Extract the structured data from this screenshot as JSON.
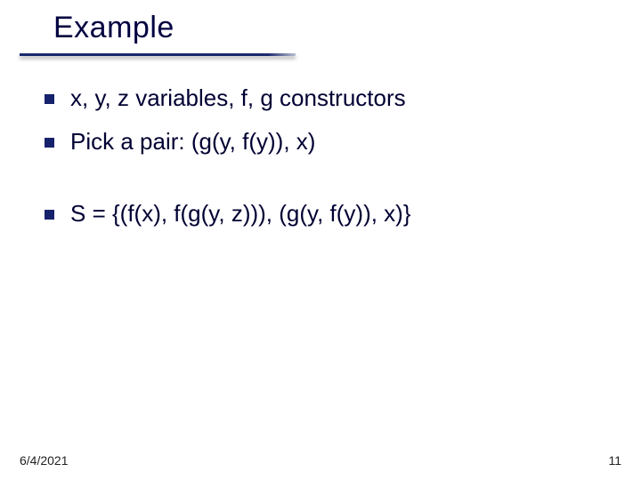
{
  "title": "Example",
  "bullets": [
    "x, y, z variables, f, g constructors",
    "Pick a pair: (g(y, f(y)), x)",
    "S = {(f(x), f(g(y, z))), (g(y, f(y)), x)}"
  ],
  "footer": {
    "date": "6/4/2021",
    "page": "11"
  }
}
